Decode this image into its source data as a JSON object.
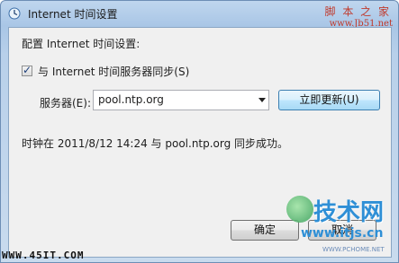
{
  "window": {
    "title": "Internet 时间设置",
    "title_icon": "clock-globe-icon"
  },
  "content": {
    "heading": "配置 Internet 时间设置:",
    "sync_checkbox": {
      "label": "与 Internet 时间服务器同步(S)",
      "checked": true
    },
    "server": {
      "label": "服务器(E):",
      "value": "pool.ntp.org"
    },
    "update_button": "立即更新(U)",
    "status": "时钟在 2011/8/12 14:24 与 pool.ntp.org 同步成功。"
  },
  "buttons": {
    "ok": "确定",
    "cancel": "取消"
  },
  "watermarks": {
    "top_right": "脚 本 之 家",
    "top_right_url": "www.Jb51.net",
    "bottom_left": "WWW.45IT.COM",
    "logo_text": "技术网",
    "logo_url": "www.itjs.cn",
    "logo_small": "WWW.PCHOME.NET"
  },
  "colors": {
    "accent": "#3c7fb1",
    "watermark_red": "#c0392b",
    "watermark_blue": "#2e8fd6"
  }
}
